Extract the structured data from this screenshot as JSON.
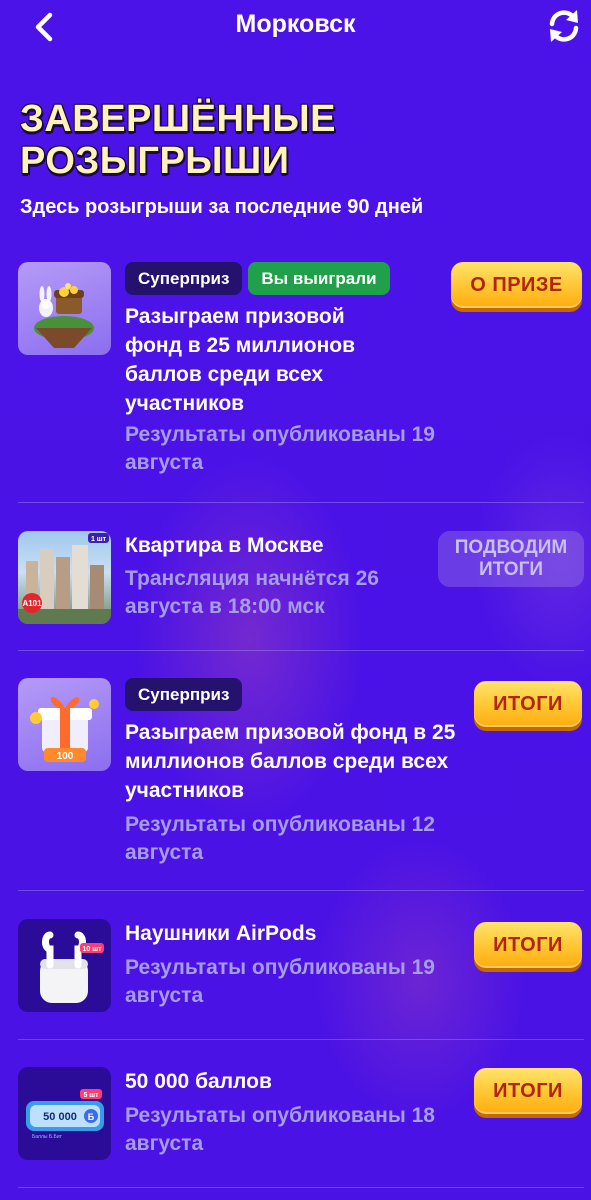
{
  "header": {
    "title": "Морковск",
    "back_icon": "chevron-left-icon",
    "refresh_icon": "refresh-icon"
  },
  "page": {
    "heading_line1": "ЗАВЕРШЁННЫЕ",
    "heading_line2": "РОЗЫГРЫШИ",
    "subheading": "Здесь розыгрыши за последние 90 дней"
  },
  "colors": {
    "background": "#4a12e6",
    "gold_button": "#ffc531",
    "badge_dark": "#24126e",
    "badge_green": "#20a04a",
    "muted_text": "#a79de6"
  },
  "raffles": [
    {
      "badges": [
        "Суперприз",
        "Вы выиграли"
      ],
      "title": "Разыграем призовой фонд в 25 миллионов баллов среди всех участников",
      "subtitle": "Результаты опубликованы 19 августа",
      "button": "О ПРИЗЕ",
      "image": "treasure-island-image"
    },
    {
      "badges": [],
      "title": "Квартира в Москве",
      "subtitle": "Трансляция начнётся 26 августа в 18:00 мск",
      "button": "подводим итоги",
      "image": "apartment-building-image",
      "image_labels": {
        "count": "1 шт",
        "tag": "А101"
      }
    },
    {
      "badges": [
        "Суперприз"
      ],
      "title": "Разыграем призовой фонд в 25 миллионов баллов среди всех участников",
      "subtitle": "Результаты опубликованы 12 августа",
      "button": "ИТОГИ",
      "image": "gift-box-image",
      "image_labels": {
        "amount": "100"
      }
    },
    {
      "badges": [],
      "title": "Наушники AirPods",
      "subtitle": "Результаты опубликованы 19 августа",
      "button": "ИТОГИ",
      "image": "airpods-image",
      "image_labels": {
        "count": "10 шт"
      }
    },
    {
      "badges": [],
      "title": "50 000 баллов",
      "subtitle": "Результаты опубликованы 18 августа",
      "button": "ИТОГИ",
      "image": "points-card-image",
      "image_labels": {
        "count": "5 шт",
        "amount": "50 000",
        "caption": "Баллы Б.Бит"
      }
    }
  ]
}
